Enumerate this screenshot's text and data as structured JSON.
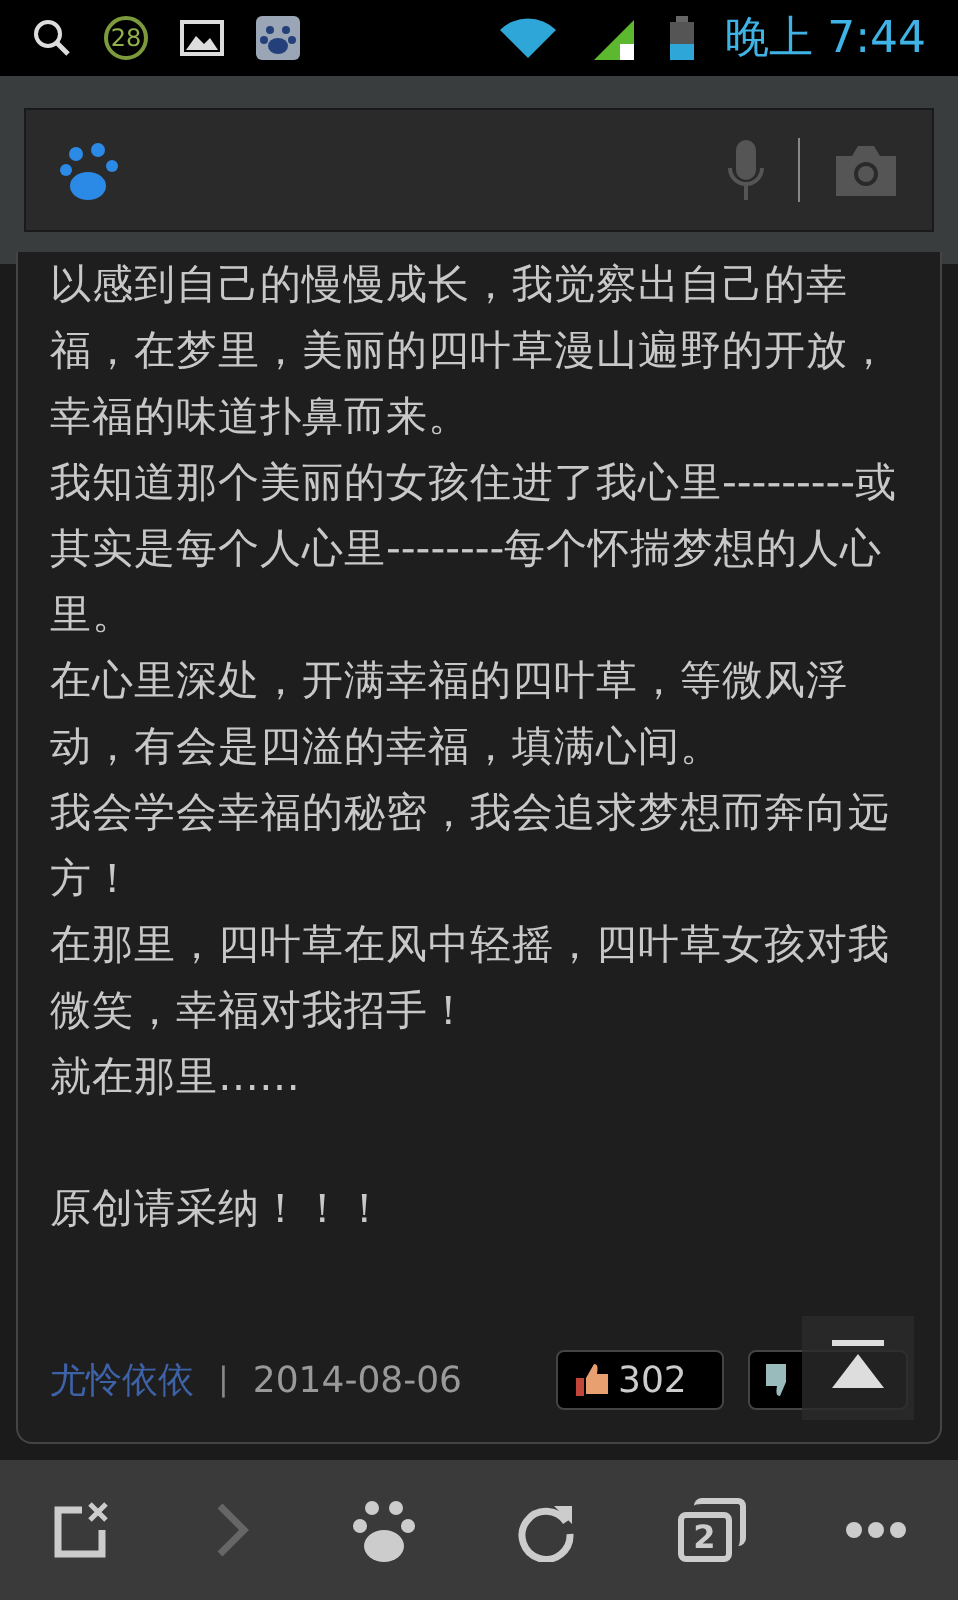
{
  "status_bar": {
    "notification_count": "28",
    "time": "晚上 7:44"
  },
  "search_bar": {
    "mic_disabled": true
  },
  "answer": {
    "paragraphs": [
      "以感到自己的慢慢成长，我觉察出自己的幸福，在梦里，美丽的四叶草漫山遍野的开放，幸福的味道扑鼻而来。",
      "我知道那个美丽的女孩住进了我心里---------或其实是每个人心里--------每个怀揣梦想的人心里。",
      "在心里深处，开满幸福的四叶草，等微风浮动，有会是四溢的幸福，填满心间。",
      "我会学会幸福的秘密，我会追求梦想而奔向远方！",
      "在那里，四叶草在风中轻摇，四叶草女孩对我微笑，幸福对我招手！",
      "就在那里……",
      "原创请采纳！！！"
    ],
    "author": "尤怜依依",
    "separator": "|",
    "date": "2014-08-06",
    "likes": "302"
  },
  "bottom_bar": {
    "forward_disabled": true,
    "tab_count": "2"
  }
}
